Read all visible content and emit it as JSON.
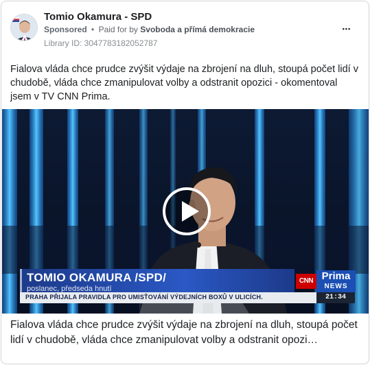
{
  "header": {
    "page_name": "Tomio Okamura - SPD",
    "sponsored_label": "Sponsored",
    "separator": "•",
    "paid_for_label": "Paid for by",
    "payer": "Svoboda a přímá demokracie",
    "library_id": "Library ID: 3047783182052787",
    "more_icon": "more-dots-icon",
    "more_label": "•••"
  },
  "post": {
    "text": "Fialova vláda chce prudce zvýšit výdaje na zbrojení na dluh, stoupá počet lidí v chudobě, vláda chce zmanipulovat volby a odstranit opozici - okomentoval jsem v TV CNN Prima."
  },
  "video": {
    "name_caption": "TOMIO OKAMURA /SPD/",
    "role_caption": "poslanec, předseda hnutí",
    "ticker": "PRAHA PŘIJALA PRAVIDLA PRO UMISŤOVÁNÍ VÝDEJNÍCH BOXŮ V ULICÍCH.",
    "clock": "21:34",
    "cnn_logo": "CNN",
    "prima_logo": "Prima",
    "news_logo": "NEWS",
    "play_icon": "play-icon"
  },
  "caption": {
    "text": "Fialova vláda chce prudce zvýšit výdaje na zbrojení na dluh, stoupá počet lidí v chudobě, vláda chce zmanipulovat volby a odstranit opozi…"
  },
  "colors": {
    "studio_blue": "#2aa3f0",
    "background_dark": "#0a1526",
    "cnn_red": "#cc0000",
    "prima_blue": "#1b4fb4"
  }
}
